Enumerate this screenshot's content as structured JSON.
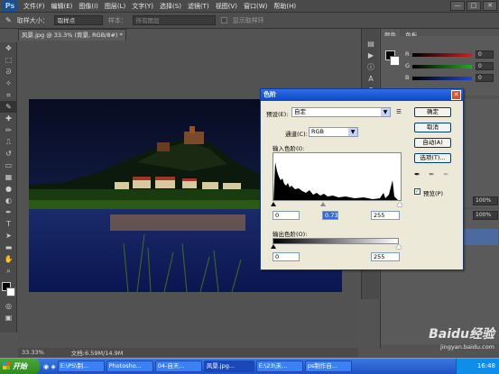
{
  "app": {
    "logo": "Ps"
  },
  "menu": [
    "文件(F)",
    "编辑(E)",
    "图像(I)",
    "图层(L)",
    "文字(Y)",
    "选择(S)",
    "滤镜(T)",
    "视图(V)",
    "窗口(W)",
    "帮助(H)"
  ],
  "window_controls": [
    "—",
    "□",
    "✕"
  ],
  "options_bar": {
    "sample_label": "取样大小：",
    "sample_value": "取样点",
    "sample_layers_label": "样本：",
    "sample_layers_value": "所有图层",
    "show_ring": "显示取样环"
  },
  "document": {
    "tab": "风景.jpg @ 33.3% (背景, RGB/8#) *",
    "close": "×"
  },
  "status": {
    "zoom": "33.33%",
    "doc": "文档:6.59M/14.9M"
  },
  "panels": {
    "color_tabs": [
      "颜色",
      "色板"
    ],
    "sliders": [
      {
        "label": "R",
        "value": "0",
        "color": "#cc2222"
      },
      {
        "label": "G",
        "value": "0",
        "color": "#22aa22"
      },
      {
        "label": "B",
        "value": "0",
        "color": "#2244cc"
      }
    ],
    "opacity_values": [
      "100%",
      "100%"
    ]
  },
  "dialog": {
    "title": "色阶",
    "close": "✕",
    "preset_label": "预设(E):",
    "preset_value": "自定",
    "channel_label": "通道(C):",
    "channel_value": "RGB",
    "input_label": "输入色阶(I):",
    "input_values": [
      "0",
      "0.73",
      "255"
    ],
    "output_label": "输出色阶(O):",
    "output_values": [
      "0",
      "255"
    ],
    "buttons": [
      "确定",
      "取消",
      "自动(A)",
      "选项(T)..."
    ],
    "preview_label": "预览(P)",
    "preview_checked": true
  },
  "taskbar": {
    "start": "开始",
    "items": [
      "E:\\PS\\制...",
      "Photosho...",
      "04-自天...",
      "风景.jpg...",
      "E:\\23\\未...",
      "ps制作自..."
    ],
    "clock": "16:48"
  },
  "watermark": {
    "brand": "Baidu经验",
    "url": "jingyan.baidu.com"
  }
}
